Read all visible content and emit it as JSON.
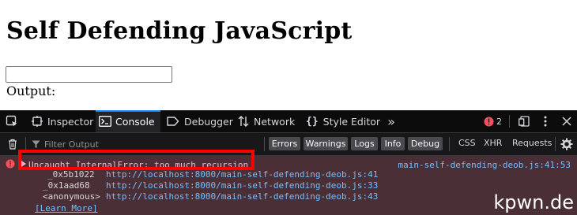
{
  "page": {
    "heading": "Self Defending JavaScript",
    "input_value": "",
    "output_label": "Output:"
  },
  "devtools": {
    "tabs": [
      {
        "label": "Inspector",
        "icon": "inspector-icon"
      },
      {
        "label": "Console",
        "icon": "console-icon",
        "selected": true
      },
      {
        "label": "Debugger",
        "icon": "debugger-icon"
      },
      {
        "label": "Network",
        "icon": "network-icon"
      },
      {
        "label": "Style Editor",
        "icon": "style-editor-icon"
      }
    ],
    "error_count": "2",
    "filter_placeholder": "Filter Output",
    "filter_buttons": [
      "Errors",
      "Warnings",
      "Logs",
      "Info",
      "Debug"
    ],
    "filter_links": [
      "CSS",
      "XHR",
      "Requests"
    ]
  },
  "console": {
    "error_message": "Uncaught InternalError: too much recursion",
    "error_source": "main-self-defending-deob.js:41:53",
    "stack": [
      {
        "fn": "_0x5b1022",
        "url": "http://localhost:8000/main-self-defending-deob.js:41"
      },
      {
        "fn": "_0x1aad68",
        "url": "http://localhost:8000/main-self-defending-deob.js:33"
      },
      {
        "fn": "<anonymous>",
        "url": "http://localhost:8000/main-self-defending-deob.js:43"
      }
    ],
    "learn_more": "[Learn More]"
  },
  "watermark": "kpwn.de",
  "colors": {
    "accent": "#0a84ff",
    "error_background": "#4b2f36",
    "error_text": "#ffb3d2",
    "link": "#75bfff",
    "highlight_box": "#ff0000"
  }
}
